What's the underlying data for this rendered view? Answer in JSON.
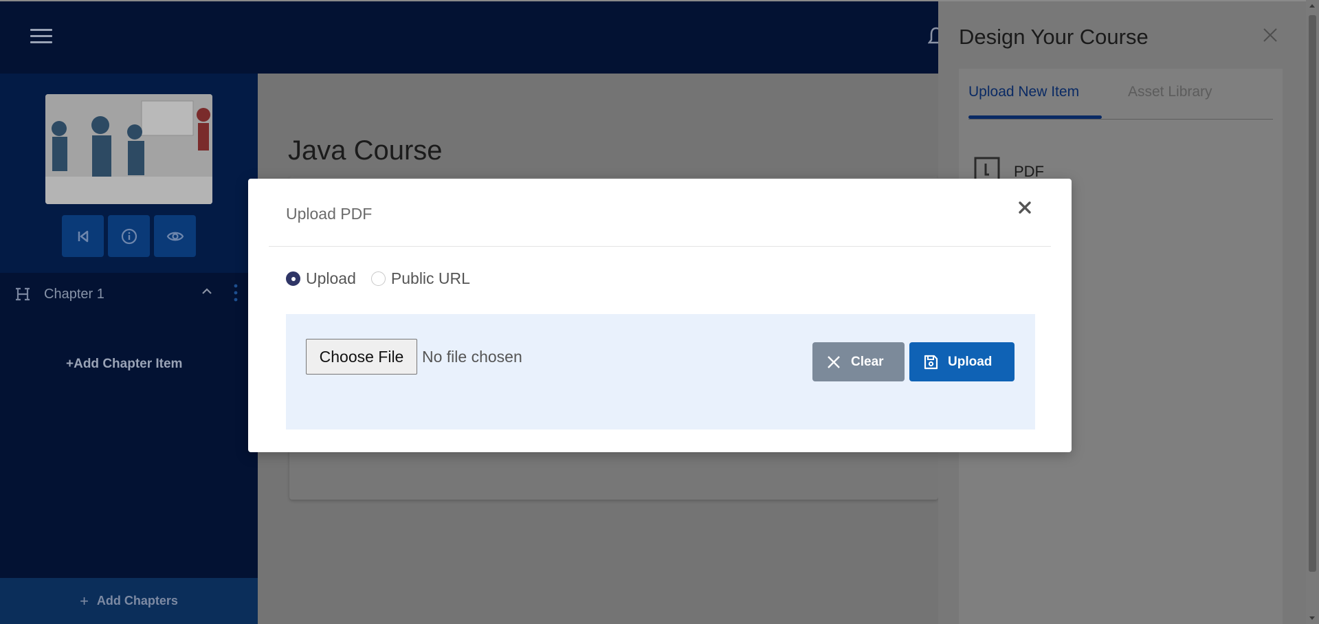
{
  "sidebar": {
    "chapters": [
      {
        "label": "Chapter 1"
      }
    ],
    "add_chapter_item": "Add Chapter Item",
    "add_chapters": "Add Chapters"
  },
  "main": {
    "course_title": "Java Course"
  },
  "panel": {
    "title": "Design Your Course",
    "tabs": [
      {
        "label": "Upload New Item",
        "active": true
      },
      {
        "label": "Asset Library",
        "active": false
      }
    ],
    "items": [
      {
        "label": "PDF",
        "icon": "pdf-icon"
      }
    ]
  },
  "modal": {
    "title": "Upload PDF",
    "radio_options": [
      {
        "label": "Upload",
        "checked": true
      },
      {
        "label": "Public URL",
        "checked": false
      }
    ],
    "file_button_label": "Choose File",
    "file_status": "No file chosen",
    "clear_label": "Clear",
    "upload_label": "Upload"
  },
  "colors": {
    "navy": "#031233",
    "primary_button": "#0f62b5",
    "secondary_button": "#7c8a9a",
    "upload_area_bg": "#e9f1fc",
    "radio_checked": "#2f3566"
  }
}
